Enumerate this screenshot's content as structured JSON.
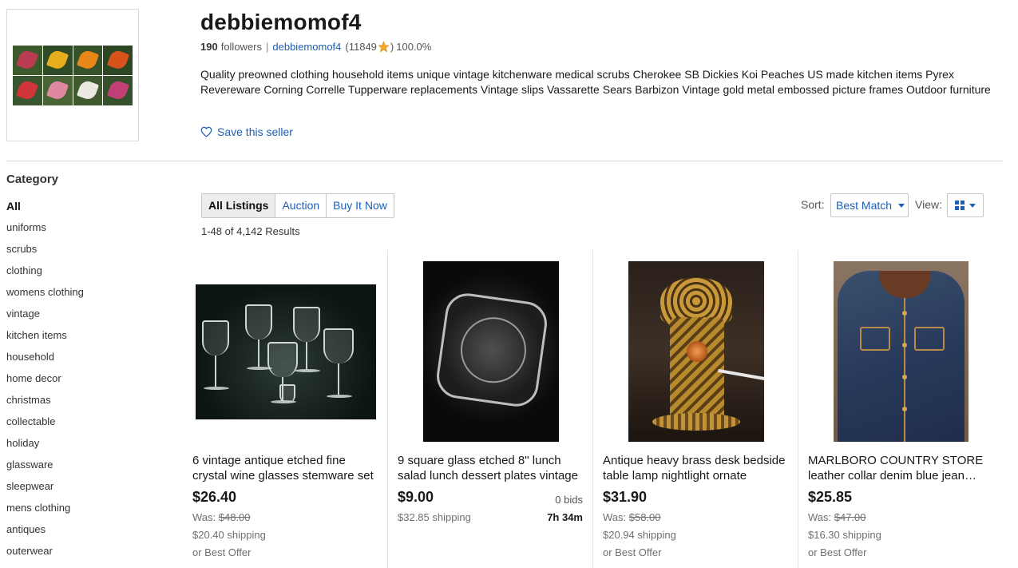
{
  "seller": {
    "name": "debbiemomof4",
    "followers": "190",
    "followers_label": "followers",
    "username": "debbiemomof4",
    "feedback_open": "(11849",
    "feedback_close": ")",
    "positive": "100.0%",
    "description": "Quality preowned clothing household items unique vintage kitchenware medical scrubs Cherokee SB Dickies Koi Peaches US made kitchen items Pyrex Revereware Corning Correlle Tupperware replacements Vintage slips Vassarette Sears Barbizon Vintage gold metal embossed picture frames Outdoor furniture",
    "save_label": "Save this seller",
    "avatar_colors": [
      "#c23b52",
      "#f2b21b",
      "#f08a16",
      "#e2541c",
      "#d9333a",
      "#e88aa8",
      "#f4f1ec",
      "#c83f7a"
    ]
  },
  "sidebar": {
    "heading": "Category",
    "items": [
      {
        "label": "All"
      },
      {
        "label": "uniforms"
      },
      {
        "label": "scrubs"
      },
      {
        "label": "clothing"
      },
      {
        "label": "womens clothing"
      },
      {
        "label": "vintage"
      },
      {
        "label": "kitchen items"
      },
      {
        "label": "household"
      },
      {
        "label": "home decor"
      },
      {
        "label": "christmas"
      },
      {
        "label": "collectable"
      },
      {
        "label": "holiday"
      },
      {
        "label": "glassware"
      },
      {
        "label": "sleepwear"
      },
      {
        "label": "mens clothing"
      },
      {
        "label": "antiques"
      },
      {
        "label": "outerwear"
      }
    ]
  },
  "tabs": [
    {
      "label": "All Listings"
    },
    {
      "label": "Auction"
    },
    {
      "label": "Buy It Now"
    }
  ],
  "results": "1-48 of 4,142 Results",
  "sort": {
    "label": "Sort:",
    "value": "Best Match"
  },
  "view": {
    "label": "View:"
  },
  "listings": [
    {
      "title": "6 vintage antique etched fine crystal wine glasses stemware set",
      "price": "$26.40",
      "was_label": "Was: ",
      "was": "$48.00",
      "shipping": "$20.40 shipping",
      "offer": "or Best Offer"
    },
    {
      "title": "9 square glass etched 8\" lunch salad lunch dessert plates vintage",
      "price": "$9.00",
      "bids": "0 bids",
      "time_left": "7h 34m",
      "shipping": "$32.85 shipping"
    },
    {
      "title": "Antique heavy brass desk bedside table lamp nightlight ornate",
      "price": "$31.90",
      "was_label": "Was: ",
      "was": "$58.00",
      "shipping": "$20.94 shipping",
      "offer": "or Best Offer"
    },
    {
      "title": "MARLBORO COUNTRY STORE leather collar denim blue jean jacket",
      "price": "$25.85",
      "was_label": "Was: ",
      "was": "$47.00",
      "shipping": "$16.30 shipping",
      "offer": "or Best Offer"
    }
  ]
}
